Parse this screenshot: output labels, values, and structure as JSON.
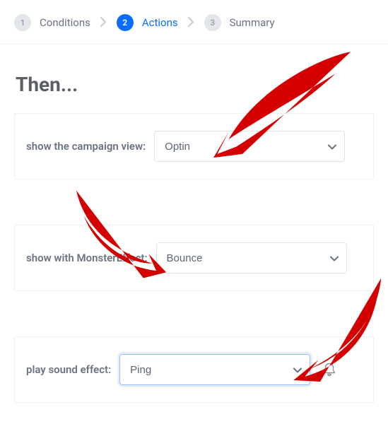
{
  "stepper": {
    "step1": {
      "num": "1",
      "label": "Conditions"
    },
    "step2": {
      "num": "2",
      "label": "Actions"
    },
    "step3": {
      "num": "3",
      "label": "Summary"
    }
  },
  "heading": "Then...",
  "rows": {
    "campaignView": {
      "label": "show the campaign view:",
      "value": "Optin"
    },
    "monsterEffect": {
      "label": "show with MonsterEffect:",
      "value": "Bounce"
    },
    "soundEffect": {
      "label": "play sound effect:",
      "value": "Ping"
    }
  },
  "colors": {
    "accent": "#0b6dff",
    "arrows": "#d40000"
  }
}
